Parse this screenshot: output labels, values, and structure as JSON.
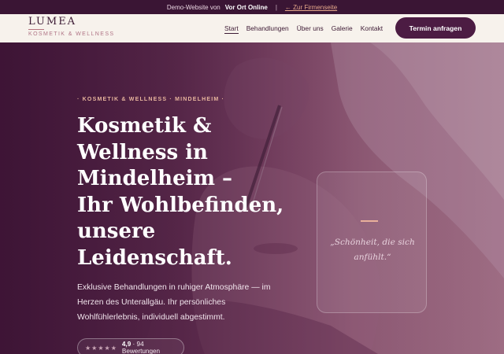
{
  "demo_bar": {
    "text": "Demo-Website von",
    "company": "Vor Ort Online",
    "separator": "|",
    "back_link": "← Zur Firmenseite"
  },
  "header": {
    "brand": "LUMEA",
    "tagline": "KOSMETIK & WELLNESS",
    "nav": [
      "Start",
      "Behandlungen",
      "Über uns",
      "Galerie",
      "Kontakt"
    ],
    "active_nav": "Start",
    "cta_label": "Termin anfragen"
  },
  "hero": {
    "eyebrow": "· KOSMETIK & WELLNESS · MINDELHEIM ·",
    "headline_lines": [
      "Kosmetik &",
      "Wellness in",
      "Mindelheim –",
      "Ihr Wohlbefinden,",
      "unsere",
      "Leidenschaft."
    ],
    "lead_lines": [
      "Exklusive Behandlungen in ruhiger Atmosphäre — im",
      "Herzen des Unterallgäu. Ihr persönliches",
      "Wohlfühlerlebnis, individuell abgestimmt."
    ],
    "rating": {
      "stars": "★★★★★",
      "score": "4,9",
      "reviews": "· 94 Bewertungen"
    },
    "quote_lines": [
      "„Schönheit, die sich",
      "anfühlt.“"
    ]
  },
  "colors": {
    "brand_dark": "#4c1c43",
    "accent": "#e9b09b",
    "header_bg": "#f7f2ec"
  }
}
